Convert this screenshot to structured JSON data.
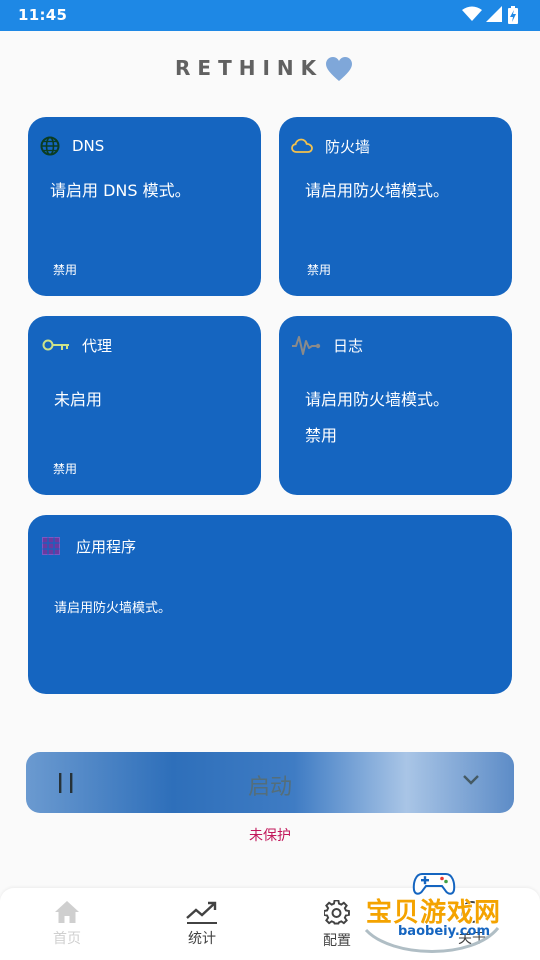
{
  "status_bar": {
    "time": "11:45"
  },
  "brand": {
    "title": "RETHINK"
  },
  "cards": {
    "dns": {
      "label": "DNS",
      "message": "请启用 DNS 模式。",
      "state": "禁用"
    },
    "firewall": {
      "label": "防火墙",
      "message": "请启用防火墙模式。",
      "state": "禁用"
    },
    "proxy": {
      "label": "代理",
      "message": "未启用",
      "state": "禁用"
    },
    "logs": {
      "label": "日志",
      "message": "请启用防火墙模式。",
      "state": "禁用"
    },
    "apps": {
      "label": "应用程序",
      "message": "请启用防火墙模式。"
    }
  },
  "start": {
    "label": "启动"
  },
  "protection_status": "未保护",
  "nav": {
    "home": "首页",
    "stats": "统计",
    "config": "配置",
    "about": "关于"
  },
  "watermark": {
    "title": "宝贝游戏网",
    "url": "baobeiy.com"
  },
  "colors": {
    "status_bar": "#1e88e5",
    "card": "#1565c0",
    "unprotected": "#c2185b",
    "heart": "#7fa7d9"
  },
  "icons": {
    "dns": "globe-icon",
    "firewall": "cloud-icon",
    "proxy": "key-icon",
    "logs": "pulse-icon",
    "apps": "grid-icon"
  }
}
